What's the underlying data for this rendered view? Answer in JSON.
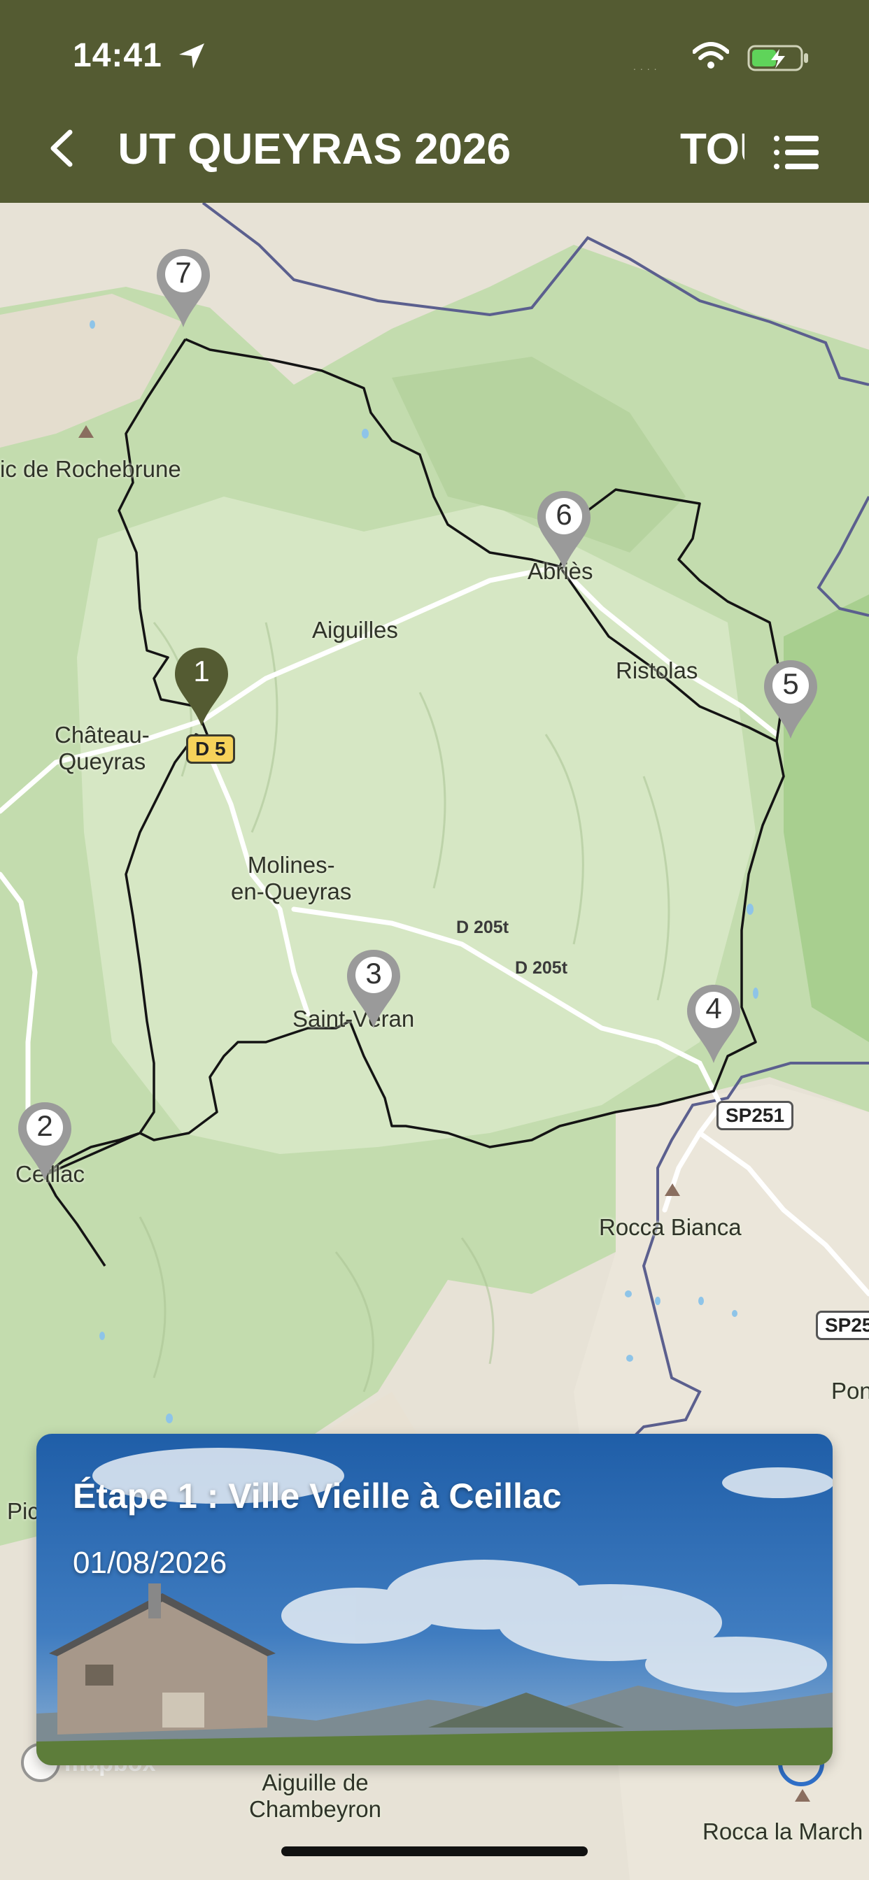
{
  "status_bar": {
    "time": "14:41",
    "signal": "....",
    "icons": [
      "location-arrow-icon",
      "wifi-icon",
      "battery-charging-icon"
    ]
  },
  "header": {
    "title": "UT QUEYRAS 2026",
    "tab_label": "TOUR",
    "back_icon": "chevron-left-icon",
    "menu_icon": "list-menu-icon",
    "background_color": "#545b32"
  },
  "map": {
    "places": [
      {
        "name": "ic de Rochebrune"
      },
      {
        "name": "Aiguilles"
      },
      {
        "name": "Abriès"
      },
      {
        "name": "Ristolas"
      },
      {
        "name": "Château-\nQueyras"
      },
      {
        "name": "Molines-\nen-Queyras"
      },
      {
        "name": "Saint-Véran"
      },
      {
        "name": "Ceillac"
      },
      {
        "name": "Rocca Bianca"
      },
      {
        "name": "Pon"
      },
      {
        "name": "Pic"
      },
      {
        "name": "Aiguille de\nChambeyron"
      },
      {
        "name": "Rocca la March"
      }
    ],
    "roads": {
      "d5": "D 5",
      "d205t_a": "D 205t",
      "d205t_b": "D 205t",
      "sp251": "SP251",
      "sp25": "SP25"
    },
    "markers": [
      {
        "number": "1",
        "active": true
      },
      {
        "number": "2",
        "active": false
      },
      {
        "number": "3",
        "active": false
      },
      {
        "number": "4",
        "active": false
      },
      {
        "number": "5",
        "active": false
      },
      {
        "number": "6",
        "active": false
      },
      {
        "number": "7",
        "active": false
      }
    ],
    "attribution": "mapbox",
    "colors": {
      "forest": "#b8d6a3",
      "route": "#1a1a1a",
      "border": "#5b5f8e",
      "marker_active": "#545b32",
      "marker_inactive": "#9a9a9a"
    }
  },
  "stage_card": {
    "title": "Étape 1 : Ville Vieille à Ceillac",
    "date": "01/08/2026"
  }
}
